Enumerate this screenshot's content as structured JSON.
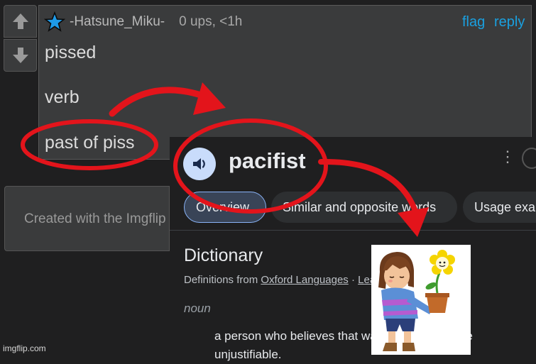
{
  "comment": {
    "username": "-Hatsune_Miku-",
    "meta": "0 ups, <1h",
    "actions": {
      "flag": "flag",
      "reply": "reply"
    },
    "lines": [
      "pissed",
      "verb",
      "past of piss"
    ]
  },
  "imgflip_notice": "Created with the Imgflip Meme Generator",
  "watermark": "imgflip.com",
  "dictionary": {
    "word": "pacifist",
    "chips": [
      "Overview",
      "Similar and opposite words",
      "Usage examples"
    ],
    "heading": "Dictionary",
    "source_prefix": "Definitions from ",
    "source_name": "Oxford Languages",
    "source_sep": " · ",
    "source_more": "Learn more",
    "part_of_speech": "noun",
    "definition": "a person who believes that war and violence are unjustifiable."
  },
  "colors": {
    "link": "#1aa0e0",
    "annotation_red": "#e3141b",
    "chip_selected_border": "#8ab4f8",
    "speaker_bg": "#c9dcfb"
  },
  "icons": [
    "upvote-arrow-icon",
    "downvote-arrow-icon",
    "star-icon",
    "speaker-icon",
    "more-vert-icon"
  ]
}
